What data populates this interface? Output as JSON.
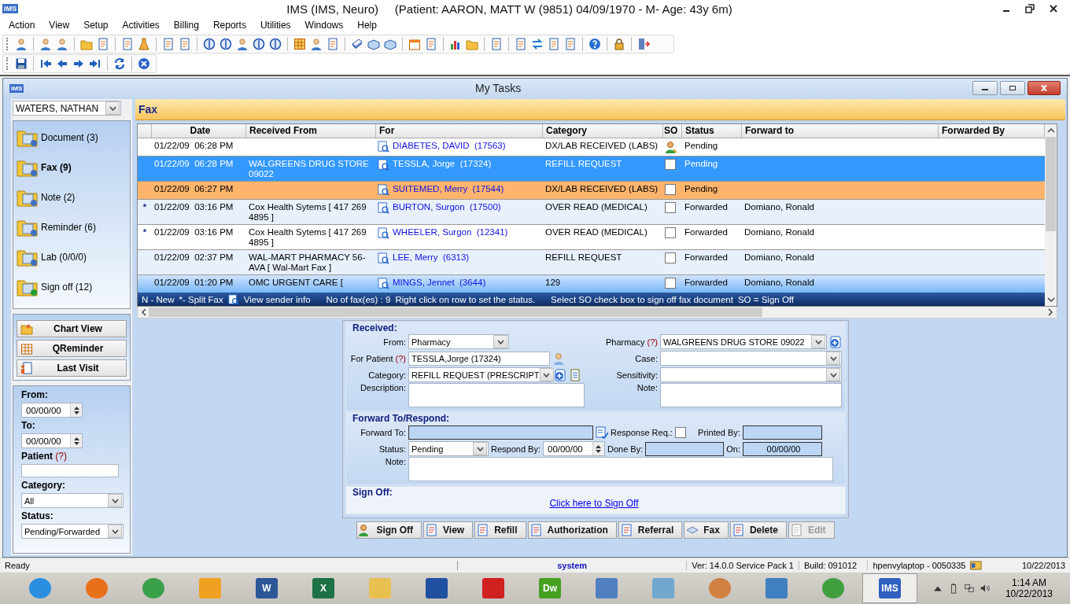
{
  "window": {
    "logo": "IMS",
    "title": "IMS (IMS, Neuro)     (Patient: AARON, MATT W (9851) 04/09/1970 - M- Age: 43y 6m)"
  },
  "menu": [
    "Action",
    "View",
    "Setup",
    "Activities",
    "Billing",
    "Reports",
    "Utilities",
    "Windows",
    "Help"
  ],
  "child_window": {
    "logo": "IMS",
    "title": "My Tasks"
  },
  "user_select": {
    "value": "WATERS, NATHAN"
  },
  "task_types": [
    {
      "label": "Document (3)",
      "selected": false
    },
    {
      "label": "Fax (9)",
      "selected": true
    },
    {
      "label": "Note (2)",
      "selected": false
    },
    {
      "label": "Reminder (6)",
      "selected": false
    },
    {
      "label": "Lab (0/0/0)",
      "selected": false
    },
    {
      "label": "Sign off (12)",
      "selected": false
    }
  ],
  "quick_buttons": [
    "Chart View",
    "QReminder",
    "Last Visit"
  ],
  "filters": {
    "from_label": "From:",
    "from": "00/00/00",
    "to_label": "To:",
    "to": "00/00/00",
    "patient_label": "Patient",
    "patient_hint": "(?)",
    "category_label": "Category:",
    "category": "All",
    "status_label": "Status:",
    "status": "Pending/Forwarded"
  },
  "section_title": "Fax",
  "table": {
    "columns": [
      "Date",
      "Received From",
      "For",
      "Category",
      "SO",
      "Status",
      "Forward to",
      "Forwarded By"
    ],
    "rows": [
      {
        "date": "01/22/09  06:28 PM",
        "for": "DIABETES, DAVID  (17563)",
        "category": "DX/LAB RECEIVED (LABS)",
        "kind": "signer",
        "status": "Pending",
        "selected": false,
        "flagged": false,
        "focused": false
      },
      {
        "date": "01/22/09  06:28 PM",
        "from": "WALGREENS DRUG STORE 09022",
        "for": "TESSLA, Jorge  (17324)",
        "category": "REFILL REQUEST",
        "kind": "checkbox",
        "checked": false,
        "status": "Pending",
        "selected": true,
        "flagged": false,
        "focused": false
      },
      {
        "date": "01/22/09  06:27 PM",
        "for": "SUITEMED, Merry  (17544)",
        "category": "DX/LAB RECEIVED (LABS)",
        "kind": "checkbox",
        "checked": false,
        "status": "Pending",
        "selected": false,
        "flagged": true,
        "focused": false
      },
      {
        "mark": "*",
        "date": "01/22/09  03:16 PM",
        "from": "Cox Health Sytems [ 417 269 4895 ]",
        "for": "BURTON, Surgon  (17500)",
        "category": "OVER READ (MEDICAL)",
        "kind": "checkbox",
        "checked": false,
        "status": "Forwarded",
        "forward_to": "Domiano, Ronald",
        "selected": false,
        "flagged": false,
        "focused": false
      },
      {
        "mark": "*",
        "date": "01/22/09  03:16 PM",
        "from": "Cox Health Sytems [ 417 269 4895 ]",
        "for": "WHEELER, Surgon  (12341)",
        "category": "OVER READ (MEDICAL)",
        "kind": "checkbox",
        "checked": false,
        "status": "Forwarded",
        "forward_to": "Domiano, Ronald",
        "selected": false,
        "flagged": false,
        "focused": false
      },
      {
        "date": "01/22/09  02:37 PM",
        "from": "WAL-MART PHARMACY 56-AVA [ Wal-Mart Fax ]",
        "for": "LEE, Merry  (6313)",
        "category": "REFILL REQUEST",
        "kind": "checkbox",
        "checked": false,
        "status": "Forwarded",
        "forward_to": "Domiano, Ronald",
        "selected": false,
        "flagged": false,
        "focused": false
      },
      {
        "date": "01/22/09  01:20 PM",
        "from": "OMC URGENT CARE [",
        "for": "MINGS, Jennet  (3644)",
        "category": "129",
        "kind": "checkbox",
        "checked": false,
        "status": "Forwarded",
        "forward_to": "Domiano, Ronald",
        "selected": false,
        "flagged": false,
        "focused": true
      }
    ]
  },
  "legend": {
    "new": "N - New",
    "split": "*- Split Fax",
    "sender": "View sender info",
    "count": "No of fax(es) : 9",
    "hint": "Right click on row to set the status.",
    "signoff": "Select SO check box to sign off fax document",
    "so": "SO = Sign Off"
  },
  "form": {
    "received_title": "Received:",
    "from_label": "From:",
    "from": "Pharmacy",
    "pharmacy_label": "Pharmacy",
    "pharmacy_hint": "(?)",
    "pharmacy": "WALGREENS DRUG STORE 09022",
    "patient_label": "For Patient",
    "patient_hint": "(?)",
    "patient": "TESSLA,Jorge (17324)",
    "case_label": "Case:",
    "category_label": "Category:",
    "category": "REFILL REQUEST (PRESCRIPT",
    "sensitivity_label": "Sensitivity:",
    "description_label": "Description:",
    "note_label": "Note:",
    "forward_title": "Forward To/Respond:",
    "forward_to_label": "Forward To:",
    "response_label": "Response Req.:",
    "response_required": false,
    "printed_by_label": "Printed By:",
    "status_label": "Status:",
    "status": "Pending",
    "respond_by_label": "Respond By:",
    "respond_by": "00/00/00",
    "done_by_label": "Done By:",
    "on_label": "On:",
    "on": "00/00/00",
    "note2_label": "Note:",
    "signoff_title": "Sign Off:",
    "signoff_link": "Click here to Sign Off"
  },
  "actions": [
    {
      "label": "Sign Off",
      "disabled": false
    },
    {
      "label": "View",
      "disabled": false
    },
    {
      "label": "Refill",
      "disabled": false
    },
    {
      "label": "Authorization",
      "disabled": false
    },
    {
      "label": "Referral",
      "disabled": false
    },
    {
      "label": "Fax",
      "disabled": false
    },
    {
      "label": "Delete",
      "disabled": false
    },
    {
      "label": "Edit",
      "disabled": true
    }
  ],
  "status_bar": {
    "left": "Ready",
    "user": "system",
    "version": "Ver: 14.0.0 Service Pack 1",
    "build": "Build: 091012",
    "machine": "hpenvylaptop - 0050335",
    "date": "10/22/2013"
  },
  "taskbar": {
    "apps": [
      {
        "kind": "ie",
        "selected": false
      },
      {
        "kind": "firefox",
        "selected": false
      },
      {
        "kind": "chrome",
        "selected": false
      },
      {
        "kind": "outlook",
        "selected": false
      },
      {
        "kind": "word",
        "label": "W",
        "selected": false
      },
      {
        "kind": "excel",
        "label": "X",
        "selected": false
      },
      {
        "kind": "explorer",
        "selected": false
      },
      {
        "kind": "remote",
        "selected": false
      },
      {
        "kind": "acrobat",
        "selected": false
      },
      {
        "kind": "dw",
        "label": "Dw",
        "selected": false
      },
      {
        "kind": "calculator",
        "selected": false
      },
      {
        "kind": "notepad",
        "selected": false
      },
      {
        "kind": "paint",
        "selected": false
      },
      {
        "kind": "control",
        "selected": false
      },
      {
        "kind": "leaf",
        "selected": false
      },
      {
        "kind": "ims",
        "label": "IMS",
        "selected": true
      }
    ],
    "time": "1:14 AM",
    "date": "10/22/2013"
  }
}
